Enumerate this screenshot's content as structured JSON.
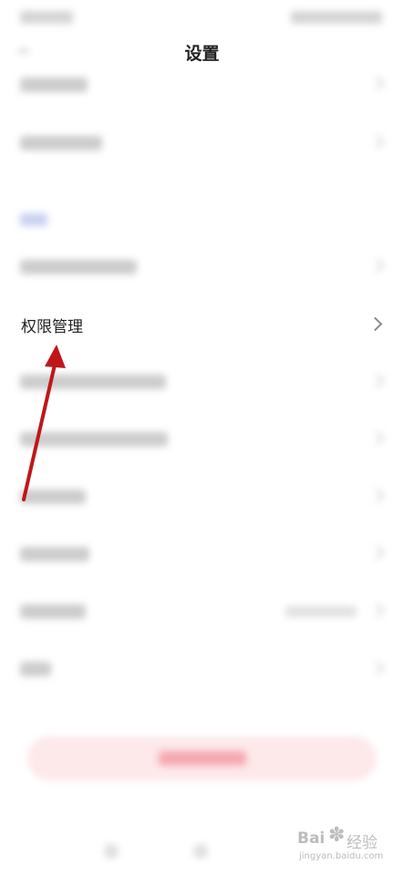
{
  "header": {
    "title": "设置"
  },
  "settings": {
    "highlighted_item": {
      "label": "权限管理"
    }
  },
  "watermark": {
    "brand": "Bai",
    "suffix": "经验",
    "url": "jingyan.baidu.com"
  },
  "annotation": {
    "arrow_color": "#c0161a"
  },
  "colors": {
    "accent_section": "#c9d0f2",
    "logout_button_bg": "#fde8ea"
  }
}
